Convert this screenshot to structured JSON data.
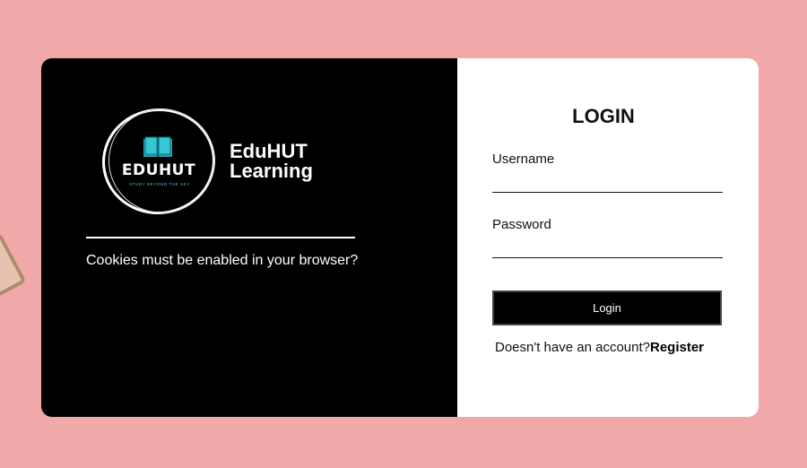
{
  "brand": {
    "logo_word": "EDUHUT",
    "logo_tagline": "STUDY BEYOND THE SKY",
    "name_line1": "EduHUT",
    "name_line2": "Learning",
    "icon": "book-icon"
  },
  "left_panel": {
    "cookie_note": "Cookies must be enabled in your browser?"
  },
  "login_form": {
    "title": "LOGIN",
    "username_label": "Username",
    "username_value": "",
    "password_label": "Password",
    "password_value": "",
    "submit_label": "Login",
    "register_prompt": "Doesn't have an account?",
    "register_link": "Register"
  },
  "colors": {
    "background": "#f0a8a8",
    "panel_dark": "#000000",
    "panel_light": "#ffffff",
    "accent": "#3cc8d8"
  }
}
